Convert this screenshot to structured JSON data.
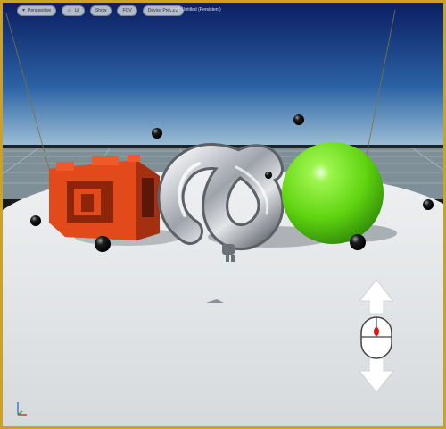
{
  "toolbar": {
    "viewmode_label": "Perspective",
    "lit_label": "Lit",
    "show_label": "Show",
    "fov_label": "FOV",
    "preview_label": "Device Preview"
  },
  "level": {
    "label": "Level:  Untitled (Persistent)"
  },
  "colors": {
    "sky_top": "#0b1e63",
    "sky_horizon": "#8fb3cc",
    "floor": "#e6e8ea",
    "cube": "#d84418",
    "sphere": "#6fe01f",
    "knot": "#c8ccd2",
    "frame": "#c9a227"
  },
  "icons": {
    "viewmode": "camera-menu-icon",
    "lit": "sun-icon",
    "pilot": "mouse-pan-gizmo-icon",
    "axes": "xyz-axis-icon"
  }
}
